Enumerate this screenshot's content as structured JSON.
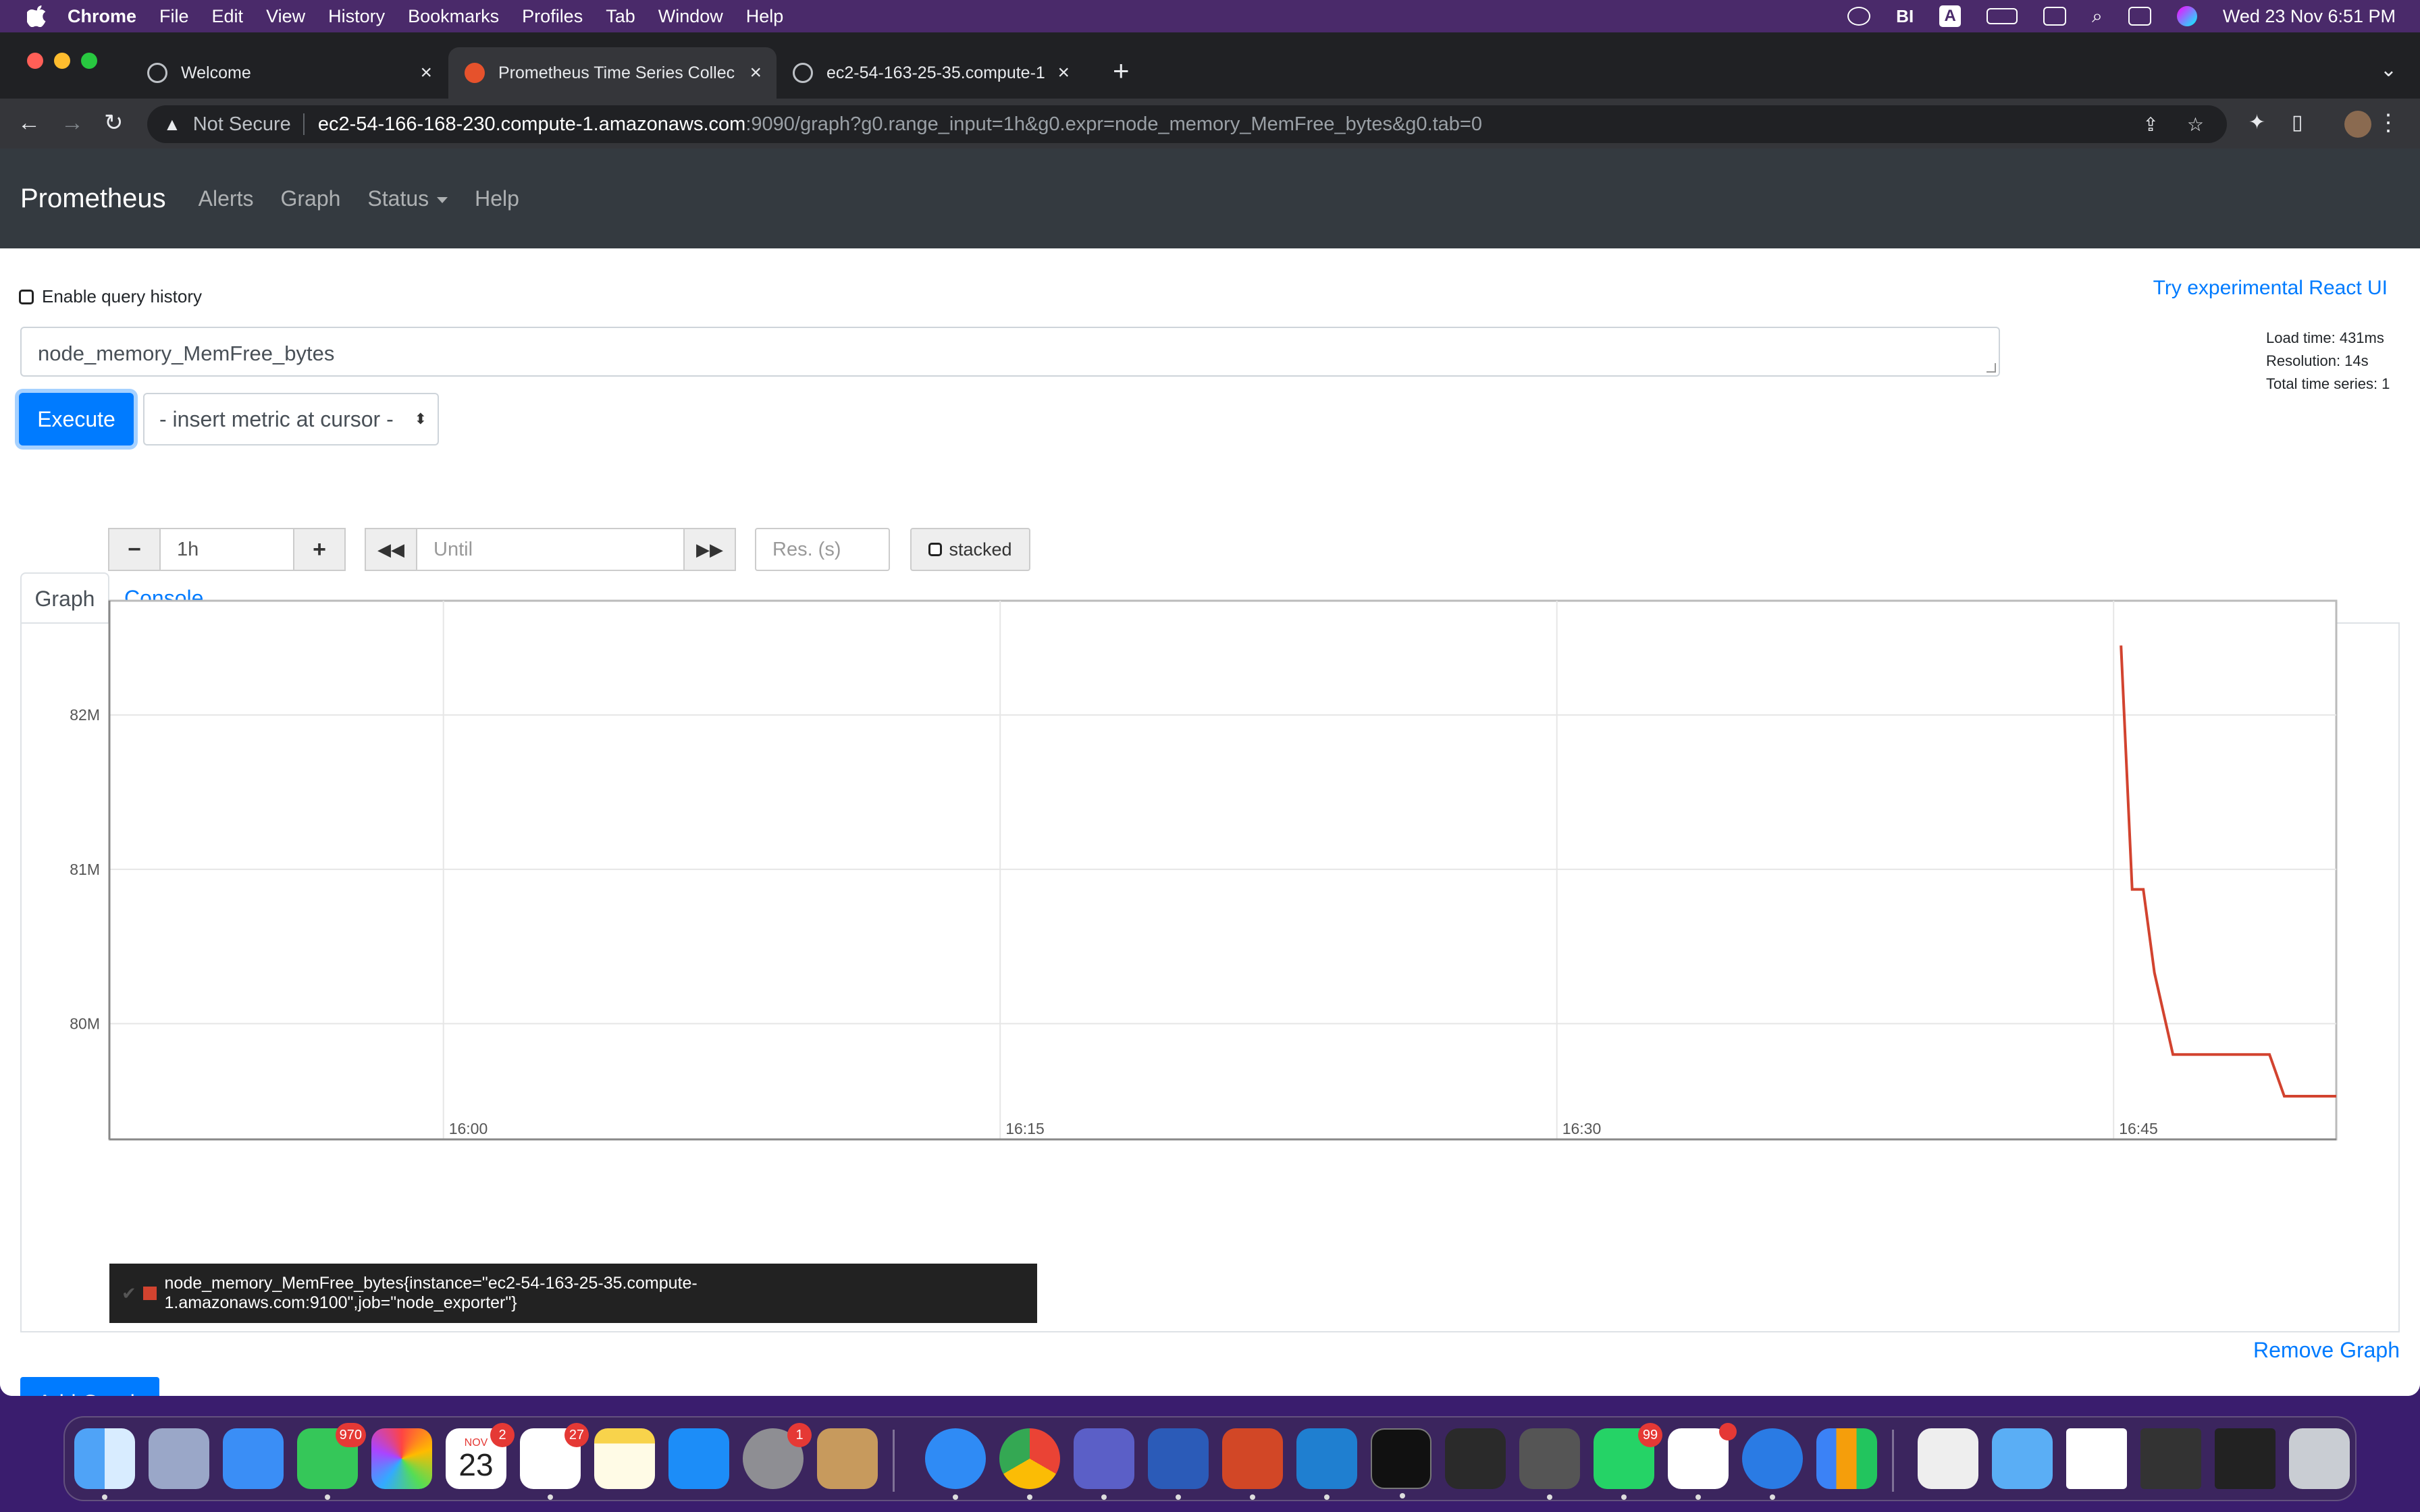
{
  "menubar": {
    "app": "Chrome",
    "items": [
      "File",
      "Edit",
      "View",
      "History",
      "Bookmarks",
      "Profiles",
      "Tab",
      "Window",
      "Help"
    ],
    "datetime": "Wed 23 Nov  6:51 PM"
  },
  "browser": {
    "tabs": [
      {
        "label": "Welcome"
      },
      {
        "label": "Prometheus Time Series Collec"
      },
      {
        "label": "ec2-54-163-25-35.compute-1"
      }
    ],
    "not_secure": "Not Secure",
    "url_host": "ec2-54-166-168-230.compute-1.amazonaws.com",
    "url_path": ":9090/graph?g0.range_input=1h&g0.expr=node_memory_MemFree_bytes&g0.tab=0"
  },
  "nav": {
    "brand": "Prometheus",
    "links": [
      "Alerts",
      "Graph",
      "Status",
      "Help"
    ]
  },
  "query": {
    "history_label": "Enable query history",
    "react_link": "Try experimental React UI",
    "expression": "node_memory_MemFree_bytes",
    "execute_label": "Execute",
    "metric_select": "- insert metric at cursor -",
    "stats": {
      "load_time": "Load time: 431ms",
      "resolution": "Resolution: 14s",
      "total_series": "Total time series: 1"
    }
  },
  "tabs": {
    "graph": "Graph",
    "console": "Console"
  },
  "controls": {
    "minus": "−",
    "range": "1h",
    "plus": "+",
    "until_placeholder": "Until",
    "res_placeholder": "Res. (s)",
    "stacked_label": "stacked"
  },
  "chart_data": {
    "type": "line",
    "x_ticks": [
      "16:00",
      "16:15",
      "16:30",
      "16:45"
    ],
    "y_ticks": [
      "80M",
      "81M",
      "82M"
    ],
    "ylim": [
      79.25,
      82.74
    ],
    "xlim_minutes_from_1551": [
      0,
      60
    ],
    "series": [
      {
        "name": "node_memory_MemFree_bytes{instance=\"ec2-54-163-25-35.compute-1.amazonaws.com:9100\",job=\"node_exporter\"}",
        "color": "#d2432f",
        "points": [
          {
            "t": 54.2,
            "v": 82.45
          },
          {
            "t": 54.5,
            "v": 80.87
          },
          {
            "t": 54.8,
            "v": 80.87
          },
          {
            "t": 55.1,
            "v": 80.33
          },
          {
            "t": 55.6,
            "v": 79.8
          },
          {
            "t": 58.2,
            "v": 79.8
          },
          {
            "t": 58.6,
            "v": 79.53
          },
          {
            "t": 60.0,
            "v": 79.53
          }
        ]
      }
    ]
  },
  "graph": {
    "remove_label": "Remove Graph",
    "add_label": "Add Graph"
  },
  "dock": {
    "badges": {
      "messages": "970",
      "calendar": "2",
      "reminders": "27",
      "settings": "1",
      "whatsapp": "99"
    },
    "calendar_month": "NOV",
    "calendar_day": "23"
  }
}
